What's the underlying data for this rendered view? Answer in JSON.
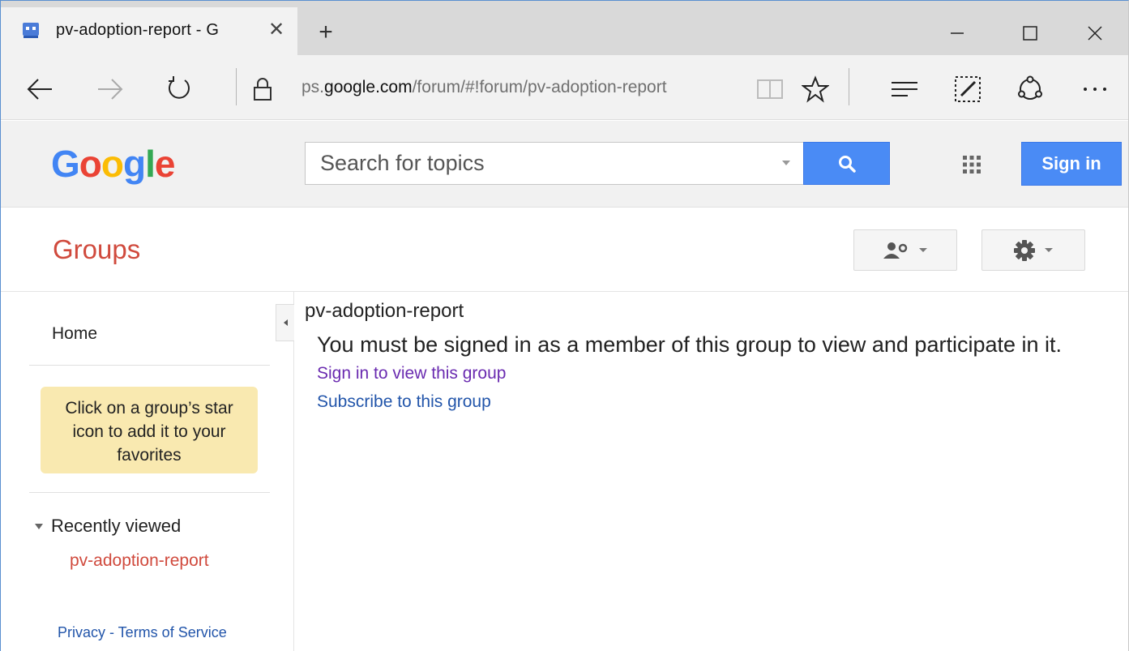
{
  "browser": {
    "tab_title": "pv-adoption-report - G",
    "address_prefix": "ps.",
    "address_host": "google.com",
    "address_path": "/forum/#!forum/pv-adoption-report"
  },
  "header": {
    "logo": "Google",
    "search_placeholder": "Search for topics",
    "signin_label": "Sign in"
  },
  "groups": {
    "title": "Groups"
  },
  "sidebar": {
    "home": "Home",
    "favorites_tip": [
      "Click on a group’s star",
      "icon to add it to your",
      "favorites"
    ],
    "recent_header": "Recently viewed",
    "recent_items": [
      "pv-adoption-report"
    ],
    "footer": "Privacy - Terms of Service"
  },
  "main": {
    "group_name": "pv-adoption-report",
    "message": "You must be signed in as a member of this group to view and participate in it.",
    "signin_link": "Sign in to view this group",
    "subscribe_link": "Subscribe to this group"
  },
  "colors": {
    "accent_blue": "#4a8bf5",
    "groups_red": "#d04a3d",
    "link_blue": "#2255aa",
    "visited_link": "#6a2bb0",
    "tip_yellow": "#f9e9b0"
  },
  "icons": [
    "google-groups-favicon",
    "close-icon",
    "plus-icon",
    "minimize-icon",
    "maximize-icon",
    "back-arrow-icon",
    "forward-arrow-icon",
    "refresh-icon",
    "lock-icon",
    "reading-view-icon",
    "star-icon",
    "hub-icon",
    "web-note-icon",
    "share-icon",
    "more-icon",
    "search-icon",
    "apps-grid-icon",
    "user-settings-icon",
    "gear-icon"
  ]
}
